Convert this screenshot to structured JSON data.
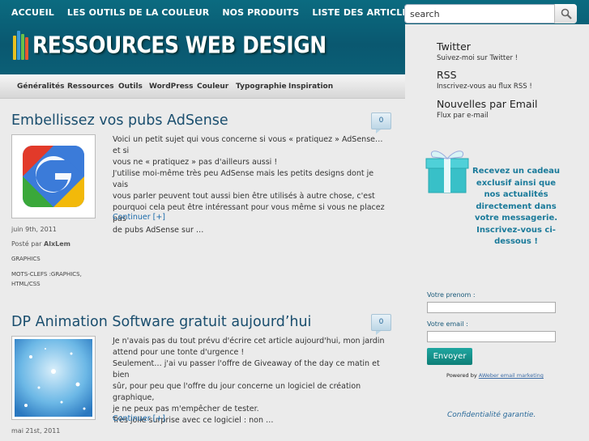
{
  "nav": {
    "items": [
      "ACCUEIL",
      "LES OUTILS DE LA COULEUR",
      "NOS PRODUITS",
      "LISTE DES ARTICLES"
    ]
  },
  "logo": {
    "text": "RESSOURCES WEB DESIGN"
  },
  "search": {
    "value": "search"
  },
  "categories": [
    "Généralités",
    "Ressources",
    "Outils",
    "WordPress",
    "Couleur",
    "Typographie",
    "Inspiration"
  ],
  "social": [
    {
      "title": "Twitter",
      "sub": "Suivez-moi sur Twitter !"
    },
    {
      "title": "RSS",
      "sub": "Inscrivez-vous au flux RSS !"
    },
    {
      "title": "Nouvelles par Email",
      "sub": "Flux par e-mail"
    }
  ],
  "promo": {
    "text": "Recevez un cadeau exclusif ainsi que nos actualités directement dans votre messagerie. Inscrivez-vous ci-dessous !"
  },
  "form": {
    "firstname_label": "Votre prenom :",
    "email_label": "Votre email :",
    "submit": "Envoyer",
    "powered_by": "Powered by",
    "powered_link": "AWeber email marketing",
    "guarantee": "Confidentialité garantie."
  },
  "posts": [
    {
      "title": "Embellissez vos pubs AdSense",
      "comments": "0",
      "body": [
        "Voici un petit sujet qui vous concerne si vous « pratiquez » AdSense… et si",
        "vous ne « pratiquez » pas d'ailleurs aussi !",
        "J'utilise moi-même très peu AdSense mais les petits designs dont je vais",
        "vous parler peuvent tout aussi bien être utilisés à autre chose, c'est",
        "pourquoi cela peut être intéressant pour vous même si vous ne placez pas",
        "de pubs AdSense sur …"
      ],
      "more": "Continuer [+]",
      "date": "juin 9th, 2011",
      "posted_by": "Posté par",
      "author": "AlxLem",
      "category": "GRAPHICS",
      "tags": [
        "MOTS-CLEFS :GRAPHICS,",
        "HTML/CSS"
      ]
    },
    {
      "title": "DP Animation Software gratuit aujourd’hui",
      "comments": "0",
      "body": [
        "Je n'avais pas du tout prévu d'écrire cet article aujourd'hui, mon jardin",
        "attend pour une tonte d'urgence !",
        "Seulement… j'ai vu passer l'offre de Giveaway of the day ce matin et bien",
        "sûr, pour peu que l'offre du jour concerne un logiciel de création graphique,",
        "je ne peux pas m'empêcher de tester.",
        "Très jolie surprise avec ce logiciel : non …"
      ],
      "more": "Continuer [+]",
      "date": "mai 21st, 2011"
    }
  ]
}
